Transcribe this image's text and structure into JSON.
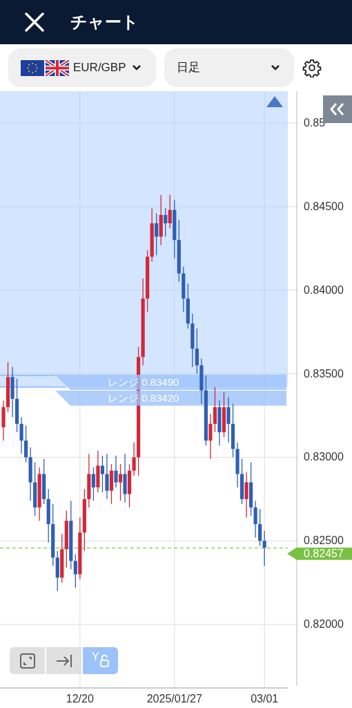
{
  "header": {
    "title": "チャート"
  },
  "pair_selector": {
    "label": "EUR/GBP"
  },
  "timeframe_selector": {
    "value": "日足"
  },
  "chart": {
    "chart_data": {
      "type": "candlestick",
      "categories": [
        null,
        null,
        null,
        null,
        null,
        null,
        null,
        null,
        null,
        null,
        null,
        null,
        null,
        null,
        null,
        null,
        null,
        "12/20",
        null,
        null,
        null,
        null,
        null,
        null,
        null,
        null,
        null,
        null,
        null,
        null,
        null,
        null,
        null,
        null,
        null,
        null,
        null,
        null,
        "2025/01/27",
        null,
        null,
        null,
        null,
        null,
        null,
        null,
        null,
        null,
        null,
        null,
        null,
        null,
        null,
        null,
        null,
        null,
        null,
        null,
        "03/01"
      ],
      "grid": true,
      "ref_lines": [
        {
          "axis": "y",
          "value": 0.8349,
          "color": "#9cc2fa"
        },
        {
          "axis": "y",
          "value": 0.8342,
          "color": "#9cc2fa"
        },
        {
          "axis": "y",
          "value": 0.82457,
          "color": "#8cc63f"
        }
      ],
      "ylim": [
        0.8162,
        0.8519
      ],
      "ohlc": [
        [
          0.8318,
          0.8334,
          0.831,
          0.833
        ],
        [
          0.833,
          0.8357,
          0.8327,
          0.8348
        ],
        [
          0.8348,
          0.8354,
          0.8324,
          0.8335
        ],
        [
          0.8335,
          0.8347,
          0.8315,
          0.832
        ],
        [
          0.832,
          0.8324,
          0.8302,
          0.831
        ],
        [
          0.831,
          0.8319,
          0.8297,
          0.83
        ],
        [
          0.83,
          0.8306,
          0.8274,
          0.8285
        ],
        [
          0.8285,
          0.8297,
          0.8265,
          0.827
        ],
        [
          0.827,
          0.8294,
          0.8262,
          0.829
        ],
        [
          0.829,
          0.8299,
          0.8272,
          0.8275
        ],
        [
          0.8275,
          0.8281,
          0.8249,
          0.826
        ],
        [
          0.826,
          0.8272,
          0.8235,
          0.824
        ],
        [
          0.824,
          0.8244,
          0.822,
          0.8228
        ],
        [
          0.8228,
          0.8254,
          0.8225,
          0.8245
        ],
        [
          0.8245,
          0.8268,
          0.8234,
          0.8262
        ],
        [
          0.8262,
          0.8274,
          0.8233,
          0.8238
        ],
        [
          0.8238,
          0.8242,
          0.8222,
          0.823
        ],
        [
          0.823,
          0.8264,
          0.8227,
          0.8255
        ],
        [
          0.8255,
          0.8281,
          0.8244,
          0.8275
        ],
        [
          0.8275,
          0.8302,
          0.827,
          0.829
        ],
        [
          0.829,
          0.8294,
          0.8274,
          0.8282
        ],
        [
          0.8282,
          0.8304,
          0.8279,
          0.8295
        ],
        [
          0.8295,
          0.8301,
          0.8279,
          0.829
        ],
        [
          0.829,
          0.8302,
          0.8275,
          0.828
        ],
        [
          0.828,
          0.8296,
          0.8272,
          0.8292
        ],
        [
          0.8292,
          0.8301,
          0.8282,
          0.8285
        ],
        [
          0.8285,
          0.8296,
          0.8274,
          0.829
        ],
        [
          0.829,
          0.8302,
          0.8273,
          0.8278
        ],
        [
          0.8278,
          0.8296,
          0.827,
          0.8292
        ],
        [
          0.8292,
          0.8309,
          0.8289,
          0.83
        ],
        [
          0.83,
          0.8366,
          0.8289,
          0.836
        ],
        [
          0.836,
          0.8407,
          0.8355,
          0.8395
        ],
        [
          0.8395,
          0.8424,
          0.8387,
          0.842
        ],
        [
          0.842,
          0.8449,
          0.8417,
          0.844
        ],
        [
          0.844,
          0.8446,
          0.8421,
          0.8432
        ],
        [
          0.8432,
          0.8457,
          0.8427,
          0.8445
        ],
        [
          0.8445,
          0.8449,
          0.8432,
          0.844
        ],
        [
          0.844,
          0.8457,
          0.8437,
          0.8448
        ],
        [
          0.8448,
          0.8454,
          0.8419,
          0.843
        ],
        [
          0.843,
          0.8442,
          0.8405,
          0.841
        ],
        [
          0.841,
          0.8414,
          0.8387,
          0.8395
        ],
        [
          0.8395,
          0.8404,
          0.8377,
          0.838
        ],
        [
          0.838,
          0.8386,
          0.8354,
          0.8365
        ],
        [
          0.8365,
          0.8377,
          0.835,
          0.8355
        ],
        [
          0.8355,
          0.8359,
          0.8332,
          0.834
        ],
        [
          0.834,
          0.8349,
          0.8307,
          0.831
        ],
        [
          0.831,
          0.8326,
          0.8299,
          0.832
        ],
        [
          0.832,
          0.8342,
          0.8315,
          0.833
        ],
        [
          0.833,
          0.8334,
          0.8307,
          0.8315
        ],
        [
          0.8315,
          0.8339,
          0.8312,
          0.833
        ],
        [
          0.833,
          0.8336,
          0.8309,
          0.832
        ],
        [
          0.832,
          0.8332,
          0.83,
          0.8305
        ],
        [
          0.8305,
          0.8309,
          0.8282,
          0.829
        ],
        [
          0.829,
          0.8299,
          0.8272,
          0.8275
        ],
        [
          0.8275,
          0.8291,
          0.8264,
          0.8285
        ],
        [
          0.8285,
          0.8297,
          0.8265,
          0.827
        ],
        [
          0.827,
          0.8274,
          0.8252,
          0.826
        ],
        [
          0.826,
          0.8269,
          0.8247,
          0.825
        ],
        [
          0.825,
          0.8256,
          0.8235,
          0.8246
        ]
      ],
      "yticks": [
        {
          "value": 0.85,
          "label": "0.85"
        },
        {
          "value": 0.845,
          "label": "0.84500"
        },
        {
          "value": 0.84,
          "label": "0.84000"
        },
        {
          "value": 0.835,
          "label": "0.83500"
        },
        {
          "value": 0.83,
          "label": "0.83000"
        },
        {
          "value": 0.825,
          "label": "0.82500"
        },
        {
          "value": 0.82,
          "label": "0.82000"
        }
      ]
    },
    "range_labels": [
      "レンジ 0.83490",
      "レンジ 0.83420"
    ],
    "current_price": "0.82457",
    "tools": [
      {
        "kind": "fit",
        "selected": false
      },
      {
        "kind": "latest",
        "selected": false
      },
      {
        "kind": "ylock",
        "label": "Y",
        "selected": true
      }
    ]
  }
}
